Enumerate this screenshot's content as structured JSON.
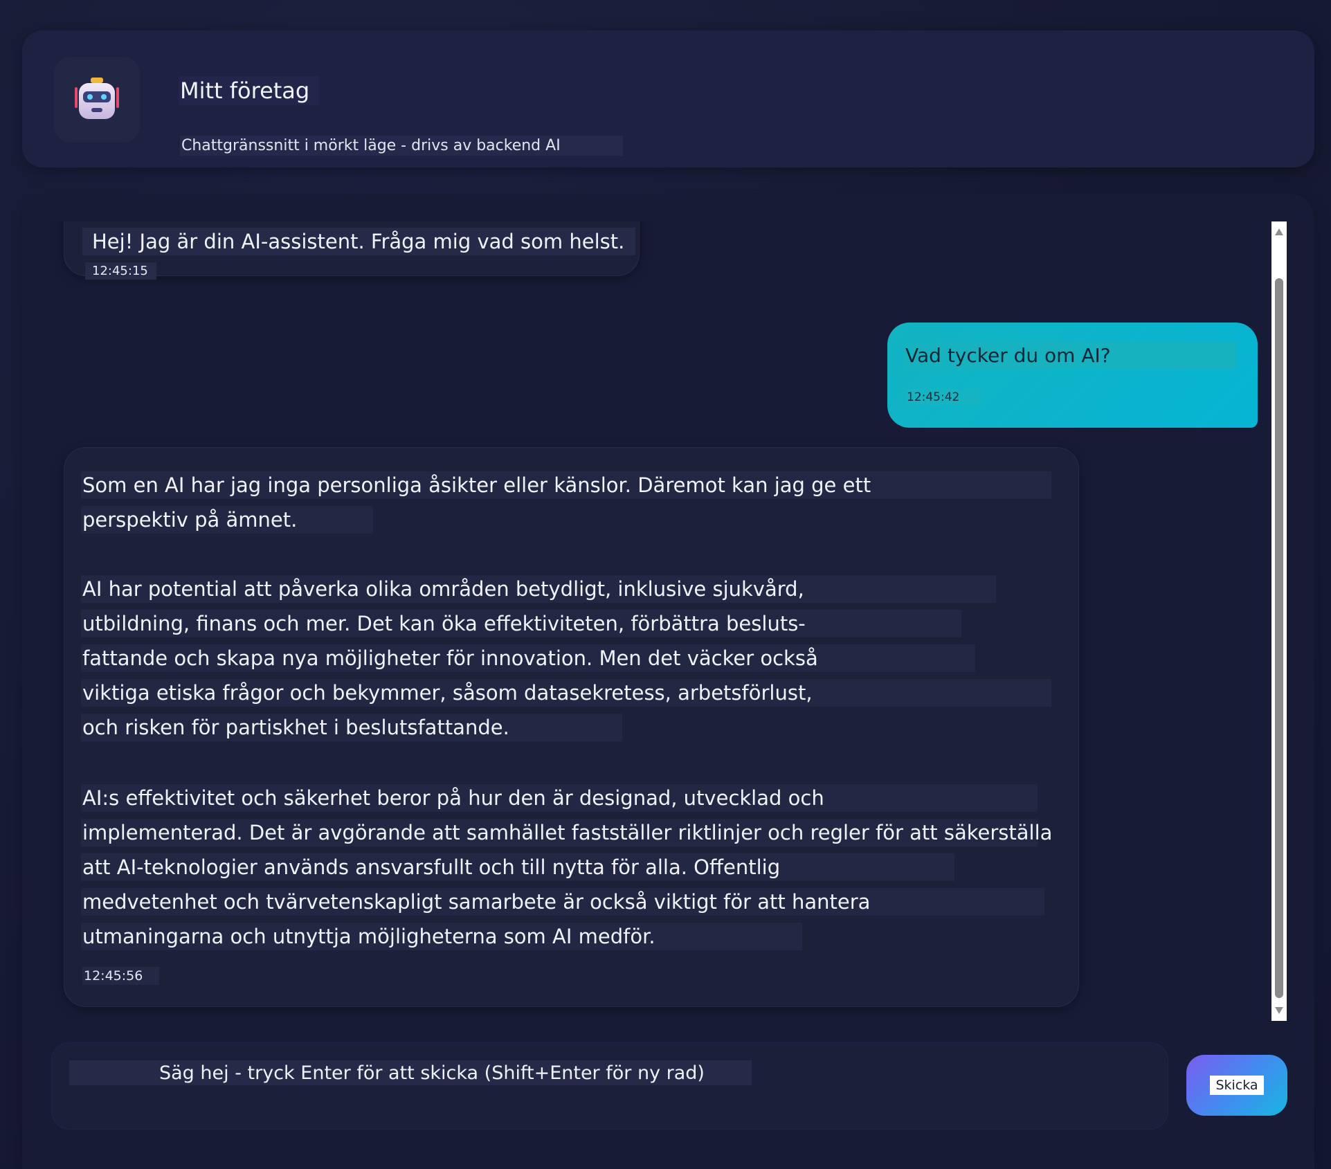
{
  "header": {
    "icon": "robot-icon",
    "title": "Mitt företag",
    "subtitle": "Chattgränssnitt i mörkt läge - drivs av backend AI"
  },
  "messages": [
    {
      "role": "assistant",
      "text": "Hej! Jag är din AI-assistent. Fråga mig vad som helst.",
      "time": "12:45:15"
    },
    {
      "role": "user",
      "text": "Vad tycker du om AI?",
      "time": "12:45:42"
    },
    {
      "role": "assistant",
      "paragraphs": [
        [
          "Som en AI har jag inga personliga åsikter eller känslor. Däremot kan jag ge ett",
          "perspektiv på ämnet."
        ],
        [
          "AI har potential att påverka olika områden betydligt, inklusive sjukvård,",
          "utbildning, finans och mer. Det kan öka effektiviteten, förbättra besluts-",
          "fattande och skapa nya möjligheter för innovation. Men det väcker också",
          "viktiga etiska frågor och bekymmer, såsom datasekretess, arbetsförlust,",
          "och risken för partiskhet i beslutsfattande."
        ],
        [
          "AI:s effektivitet och säkerhet beror på hur den är designad, utvecklad och",
          "implementerad. Det är avgörande att samhället fastställer riktlinjer och regler för att säkerställa",
          "att AI-teknologier används ansvarsfullt och till nytta för alla. Offentlig",
          "medvetenhet och tvärvetenskapligt samarbete är också viktigt för att hantera",
          "utmaningarna och utnyttja möjligheterna som AI medför."
        ]
      ],
      "time": "12:45:56"
    }
  ],
  "composer": {
    "placeholder": "Säg hej - tryck Enter för att skicka (Shift+Enter för ny rad)",
    "value": "",
    "send_label": "Skicka"
  },
  "colors": {
    "background": "#171a33",
    "user_bubble": "#06b5d4",
    "assistant_bubble": "#1c2039",
    "send_gradient_start": "#7b5cf0",
    "send_gradient_end": "#18b6e0"
  }
}
